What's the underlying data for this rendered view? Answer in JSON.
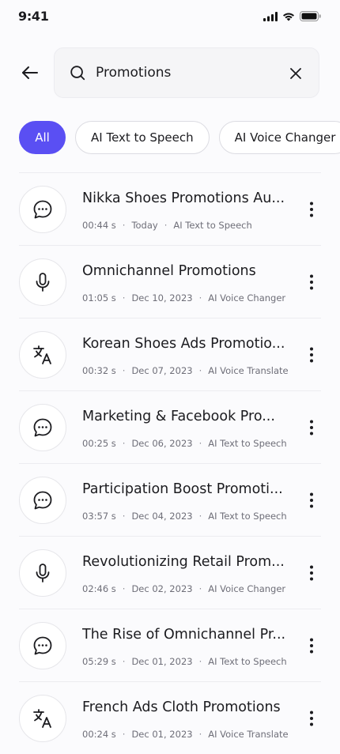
{
  "status_bar": {
    "time": "9:41"
  },
  "search": {
    "query": "Promotions",
    "placeholder": ""
  },
  "filters": [
    {
      "label": "All",
      "active": true
    },
    {
      "label": "AI Text to Speech",
      "active": false
    },
    {
      "label": "AI Voice Changer",
      "active": false
    }
  ],
  "accent_color": "#5a4ff3",
  "items": [
    {
      "title": "Nikka Shoes Promotions Au...",
      "duration": "00:44 s",
      "date": "Today",
      "category": "AI Text to Speech",
      "icon": "chat-bubble-icon"
    },
    {
      "title": "Omnichannel Promotions",
      "duration": "01:05 s",
      "date": "Dec 10, 2023",
      "category": "AI Voice Changer",
      "icon": "microphone-icon"
    },
    {
      "title": "Korean Shoes Ads Promotio...",
      "duration": "00:32 s",
      "date": "Dec 07, 2023",
      "category": "AI Voice Translate",
      "icon": "translate-icon"
    },
    {
      "title": "Marketing & Facebook Pro...",
      "duration": "00:25 s",
      "date": "Dec 06, 2023",
      "category": "AI Text to Speech",
      "icon": "chat-bubble-icon"
    },
    {
      "title": "Participation Boost Promoti...",
      "duration": "03:57 s",
      "date": "Dec 04, 2023",
      "category": "AI Text to Speech",
      "icon": "chat-bubble-icon"
    },
    {
      "title": "Revolutionizing Retail Prom...",
      "duration": "02:46 s",
      "date": "Dec 02, 2023",
      "category": "AI Voice Changer",
      "icon": "microphone-icon"
    },
    {
      "title": "The Rise of Omnichannel Pr...",
      "duration": "05:29 s",
      "date": "Dec 01, 2023",
      "category": "AI Text to Speech",
      "icon": "chat-bubble-icon"
    },
    {
      "title": "French Ads Cloth Promotions",
      "duration": "00:24 s",
      "date": "Dec 01, 2023",
      "category": "AI Voice Translate",
      "icon": "translate-icon"
    }
  ]
}
